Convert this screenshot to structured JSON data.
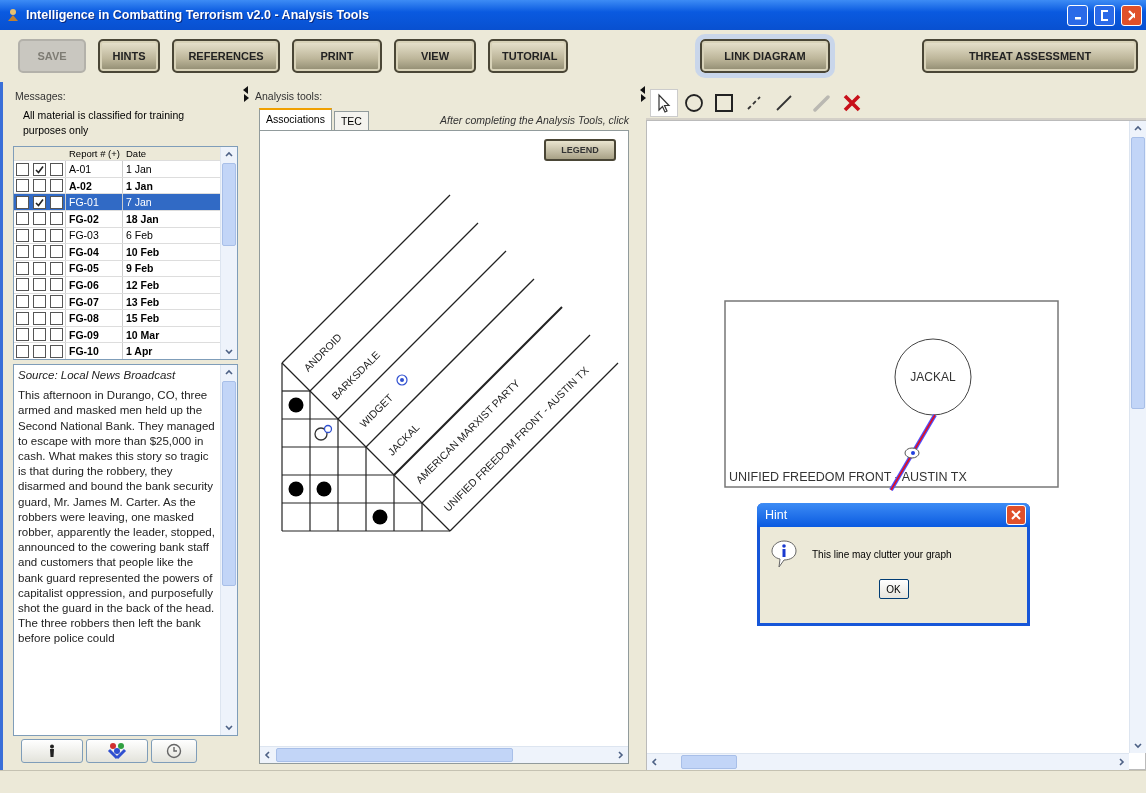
{
  "window": {
    "title": "Intelligence in Combatting Terrorism v2.0 - Analysis Tools"
  },
  "toolbar": [
    {
      "label": "SAVE",
      "disabled": true,
      "selected": false
    },
    {
      "label": "HINTS",
      "disabled": false,
      "selected": false
    },
    {
      "label": "REFERENCES",
      "disabled": false,
      "selected": false
    },
    {
      "label": "PRINT",
      "disabled": false,
      "selected": false
    },
    {
      "label": "VIEW",
      "disabled": false,
      "selected": false
    },
    {
      "label": "TUTORIAL",
      "disabled": false,
      "selected": false
    },
    {
      "label": "LINK DIAGRAM",
      "disabled": false,
      "selected": true
    },
    {
      "label": "THREAT ASSESSMENT",
      "disabled": false,
      "selected": false
    }
  ],
  "messages": {
    "title": "Messages:",
    "notice": "All material is classified for training purposes only",
    "columns": [
      "Report # (+)",
      "Date"
    ],
    "rows": [
      {
        "checks": [
          false,
          true,
          false
        ],
        "report": "A-01",
        "date": "1 Jan",
        "unread": false,
        "selected": false
      },
      {
        "checks": [
          false,
          false,
          false
        ],
        "report": "A-02",
        "date": "1 Jan",
        "unread": true,
        "selected": false
      },
      {
        "checks": [
          false,
          true,
          false
        ],
        "report": "FG-01",
        "date": "7 Jan",
        "unread": false,
        "selected": true
      },
      {
        "checks": [
          false,
          false,
          false
        ],
        "report": "FG-02",
        "date": "18 Jan",
        "unread": true,
        "selected": false
      },
      {
        "checks": [
          false,
          false,
          false
        ],
        "report": "FG-03",
        "date": "6 Feb",
        "unread": false,
        "selected": false
      },
      {
        "checks": [
          false,
          false,
          false
        ],
        "report": "FG-04",
        "date": "10 Feb",
        "unread": true,
        "selected": false
      },
      {
        "checks": [
          false,
          false,
          false
        ],
        "report": "FG-05",
        "date": "9 Feb",
        "unread": true,
        "selected": false
      },
      {
        "checks": [
          false,
          false,
          false
        ],
        "report": "FG-06",
        "date": "12 Feb",
        "unread": true,
        "selected": false
      },
      {
        "checks": [
          false,
          false,
          false
        ],
        "report": "FG-07",
        "date": "13 Feb",
        "unread": true,
        "selected": false
      },
      {
        "checks": [
          false,
          false,
          false
        ],
        "report": "FG-08",
        "date": "15 Feb",
        "unread": true,
        "selected": false
      },
      {
        "checks": [
          false,
          false,
          false
        ],
        "report": "FG-09",
        "date": "10 Mar",
        "unread": true,
        "selected": false
      },
      {
        "checks": [
          false,
          false,
          false
        ],
        "report": "FG-10",
        "date": "1 Apr",
        "unread": true,
        "selected": false
      }
    ],
    "source": "Source: Local News Broadcast",
    "body": "This afternoon in Durango, CO, three armed and masked men held up the Second National Bank.  They managed to escape with more than $25,000 in cash.  What makes this story so tragic is that during the robbery, they disarmed and bound the bank security guard, Mr. James M. Carter.  As the robbers were leaving, one masked robber, apparently the leader, stopped, announced to the cowering bank staff and customers that people like the bank guard represented the powers of capitalist oppression, and purposefully shot the guard in the back of the head. The three robbers then left the bank before police could"
  },
  "analysis": {
    "title": "Analysis tools:",
    "tabs": [
      {
        "label": "Associations",
        "selected": true
      },
      {
        "label": "TEC",
        "selected": false
      }
    ],
    "instruction": "After completing the Analysis Tools, click",
    "legend_button": "LEGEND",
    "entities": [
      "ANDROID",
      "BARKSDALE",
      "WIDGET",
      "JACKAL",
      "AMERICAN MARXIST PARTY",
      "UNIFIED FREEDOM FRONT - AUSTIN TX"
    ],
    "matrix": [
      {
        "cells": [
          {
            "kind": "dot"
          }
        ]
      },
      {
        "cells": [
          {
            "kind": "empty"
          },
          {
            "kind": "query"
          }
        ]
      },
      {
        "cells": [
          {
            "kind": "empty"
          },
          {
            "kind": "empty"
          },
          {
            "kind": "empty"
          }
        ]
      },
      {
        "cells": [
          {
            "kind": "dot"
          },
          {
            "kind": "dot"
          },
          {
            "kind": "empty"
          },
          {
            "kind": "empty"
          }
        ]
      },
      {
        "cells": [
          {
            "kind": "empty"
          },
          {
            "kind": "empty"
          },
          {
            "kind": "empty"
          },
          {
            "kind": "dot"
          },
          {
            "kind": "empty"
          }
        ]
      }
    ]
  },
  "link_diagram": {
    "tools": [
      {
        "kind": "pointer",
        "selected": true,
        "disabled": false
      },
      {
        "kind": "circle",
        "selected": false,
        "disabled": false
      },
      {
        "kind": "square",
        "selected": false,
        "disabled": false
      },
      {
        "kind": "dashed-line",
        "selected": false,
        "disabled": false
      },
      {
        "kind": "line",
        "selected": false,
        "disabled": false
      },
      {
        "kind": "pencil",
        "selected": false,
        "disabled": true
      },
      {
        "kind": "delete",
        "selected": false,
        "disabled": false
      }
    ],
    "group_label": "UNIFIED FREEDOM FRONT - AUSTIN TX",
    "node_label": "JACKAL"
  },
  "dialog": {
    "title": "Hint",
    "message": "This line may clutter your graph",
    "button": "OK"
  }
}
